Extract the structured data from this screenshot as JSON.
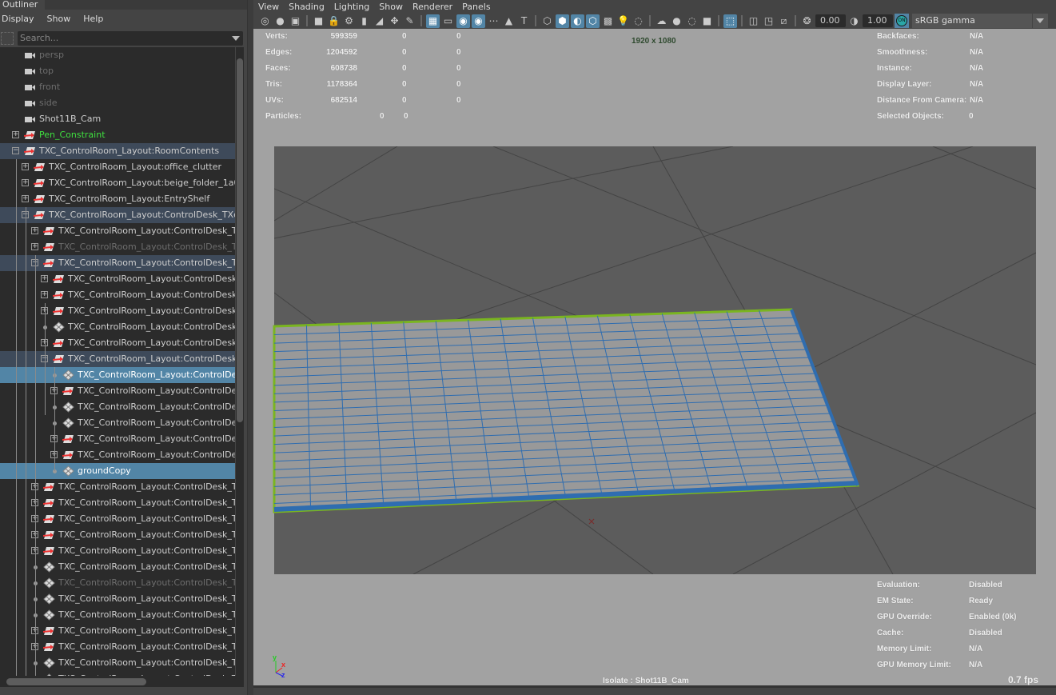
{
  "outliner": {
    "tab": "Outliner",
    "menu": [
      "Display",
      "Show",
      "Help"
    ],
    "search_placeholder": "Search...",
    "rows": [
      {
        "name": "persp",
        "level": 0,
        "exp": "none",
        "icon": "camera",
        "state": "dim"
      },
      {
        "name": "top",
        "level": 0,
        "exp": "none",
        "icon": "camera",
        "state": "dim"
      },
      {
        "name": "front",
        "level": 0,
        "exp": "none",
        "icon": "camera",
        "state": "dim"
      },
      {
        "name": "side",
        "level": 0,
        "exp": "none",
        "icon": "camera",
        "state": "dim"
      },
      {
        "name": "Shot11B_Cam",
        "level": 0,
        "exp": "none",
        "icon": "camera",
        "state": ""
      },
      {
        "name": "Pen_Constraint",
        "level": 0,
        "exp": "plus",
        "icon": "transform",
        "state": "green"
      },
      {
        "name": "TXC_ControlRoom_Layout:RoomContents",
        "level": 0,
        "exp": "minus",
        "icon": "transform",
        "state": "hl"
      },
      {
        "name": "TXC_ControlRoom_Layout:office_clutter",
        "level": 1,
        "exp": "plus",
        "icon": "transform",
        "state": ""
      },
      {
        "name": "TXC_ControlRoom_Layout:beige_folder_1a04",
        "level": 1,
        "exp": "plus",
        "icon": "transform",
        "state": ""
      },
      {
        "name": "TXC_ControlRoom_Layout:EntryShelf",
        "level": 1,
        "exp": "plus",
        "icon": "transform",
        "state": ""
      },
      {
        "name": "TXC_ControlRoom_Layout:ControlDesk_TXc:C",
        "level": 1,
        "exp": "minus",
        "icon": "transform",
        "state": "hl"
      },
      {
        "name": "TXC_ControlRoom_Layout:ControlDesk_TXc",
        "level": 2,
        "exp": "plus",
        "icon": "transform",
        "state": ""
      },
      {
        "name": "TXC_ControlRoom_Layout:ControlDesk_TXc",
        "level": 2,
        "exp": "plus",
        "icon": "transform",
        "state": "dim"
      },
      {
        "name": "TXC_ControlRoom_Layout:ControlDesk_TXc",
        "level": 2,
        "exp": "minus",
        "icon": "transform",
        "state": "hl"
      },
      {
        "name": "TXC_ControlRoom_Layout:ControlDesk_T",
        "level": 3,
        "exp": "plus",
        "icon": "transform",
        "state": ""
      },
      {
        "name": "TXC_ControlRoom_Layout:ControlDesk_T",
        "level": 3,
        "exp": "plus",
        "icon": "transform",
        "state": ""
      },
      {
        "name": "TXC_ControlRoom_Layout:ControlDesk_T",
        "level": 3,
        "exp": "plus",
        "icon": "transform",
        "state": ""
      },
      {
        "name": "TXC_ControlRoom_Layout:ControlDesk_T",
        "level": 3,
        "exp": "dot",
        "icon": "mesh",
        "state": ""
      },
      {
        "name": "TXC_ControlRoom_Layout:ControlDesk_T",
        "level": 3,
        "exp": "plus",
        "icon": "transform",
        "state": ""
      },
      {
        "name": "TXC_ControlRoom_Layout:ControlDesk_T",
        "level": 3,
        "exp": "minus",
        "icon": "transform",
        "state": "hl"
      },
      {
        "name": "TXC_ControlRoom_Layout:ControlDesk",
        "level": 4,
        "exp": "dot",
        "icon": "mesh",
        "state": "sel"
      },
      {
        "name": "TXC_ControlRoom_Layout:ControlDesk",
        "level": 4,
        "exp": "plus",
        "icon": "transform",
        "state": ""
      },
      {
        "name": "TXC_ControlRoom_Layout:ControlDesk",
        "level": 4,
        "exp": "dot",
        "icon": "mesh",
        "state": ""
      },
      {
        "name": "TXC_ControlRoom_Layout:ControlDesk",
        "level": 4,
        "exp": "dot",
        "icon": "mesh",
        "state": ""
      },
      {
        "name": "TXC_ControlRoom_Layout:ControlDesk",
        "level": 4,
        "exp": "plus",
        "icon": "transform",
        "state": ""
      },
      {
        "name": "TXC_ControlRoom_Layout:ControlDesk",
        "level": 4,
        "exp": "plus",
        "icon": "transform",
        "state": ""
      },
      {
        "name": "groundCopy",
        "level": 4,
        "exp": "dot",
        "icon": "mesh",
        "state": "sel"
      },
      {
        "name": "TXC_ControlRoom_Layout:ControlDesk_TXc",
        "level": 2,
        "exp": "plus",
        "icon": "transform",
        "state": ""
      },
      {
        "name": "TXC_ControlRoom_Layout:ControlDesk_TXc",
        "level": 2,
        "exp": "plus",
        "icon": "transform",
        "state": ""
      },
      {
        "name": "TXC_ControlRoom_Layout:ControlDesk_TXc",
        "level": 2,
        "exp": "plus",
        "icon": "transform",
        "state": ""
      },
      {
        "name": "TXC_ControlRoom_Layout:ControlDesk_TXc",
        "level": 2,
        "exp": "plus",
        "icon": "transform",
        "state": ""
      },
      {
        "name": "TXC_ControlRoom_Layout:ControlDesk_TXc",
        "level": 2,
        "exp": "plus",
        "icon": "transform",
        "state": ""
      },
      {
        "name": "TXC_ControlRoom_Layout:ControlDesk_TXc",
        "level": 2,
        "exp": "dot",
        "icon": "mesh",
        "state": ""
      },
      {
        "name": "TXC_ControlRoom_Layout:ControlDesk_TXc",
        "level": 2,
        "exp": "dot",
        "icon": "mesh",
        "state": "dim"
      },
      {
        "name": "TXC_ControlRoom_Layout:ControlDesk_TXc",
        "level": 2,
        "exp": "dot",
        "icon": "mesh",
        "state": ""
      },
      {
        "name": "TXC_ControlRoom_Layout:ControlDesk_TXc",
        "level": 2,
        "exp": "dot",
        "icon": "mesh",
        "state": ""
      },
      {
        "name": "TXC_ControlRoom_Layout:ControlDesk_TXc",
        "level": 2,
        "exp": "plus",
        "icon": "transform",
        "state": ""
      },
      {
        "name": "TXC_ControlRoom_Layout:ControlDesk_TXc",
        "level": 2,
        "exp": "plus",
        "icon": "transform",
        "state": ""
      },
      {
        "name": "TXC_ControlRoom_Layout:ControlDesk_TXc",
        "level": 2,
        "exp": "dot",
        "icon": "mesh",
        "state": ""
      },
      {
        "name": "TXC_ControlRoom_Layout:ControlDesk_TXc",
        "level": 2,
        "exp": "dot",
        "icon": "mesh",
        "state": ""
      }
    ]
  },
  "viewport": {
    "menu": [
      "View",
      "Shading",
      "Lighting",
      "Show",
      "Renderer",
      "Panels"
    ],
    "toolbar": [
      {
        "icon": "select-camera-icon",
        "glyph": "◎"
      },
      {
        "icon": "camera-attributes-icon",
        "glyph": "●"
      },
      {
        "icon": "bookmark-icon",
        "glyph": "▣"
      },
      {
        "sep": true
      },
      {
        "icon": "camera-icon",
        "glyph": "■"
      },
      {
        "icon": "lock-camera-icon",
        "glyph": "🔒"
      },
      {
        "icon": "camera-attr-icon",
        "glyph": "⚙"
      },
      {
        "icon": "bookmark2-icon",
        "glyph": "▮"
      },
      {
        "icon": "image-plane-icon",
        "glyph": "◢"
      },
      {
        "icon": "2d-pan-zoom-icon",
        "glyph": "✥"
      },
      {
        "icon": "grease-pencil-icon",
        "glyph": "✎"
      },
      {
        "sep": true
      },
      {
        "icon": "grid-icon",
        "glyph": "▦",
        "on": true
      },
      {
        "icon": "film-gate-icon",
        "glyph": "▭"
      },
      {
        "icon": "resolution-gate-icon",
        "glyph": "◉",
        "on": true
      },
      {
        "icon": "gate-mask-icon",
        "glyph": "◉",
        "on": true
      },
      {
        "icon": "field-chart-icon",
        "glyph": "⋯"
      },
      {
        "icon": "safe-action-icon",
        "glyph": "▲"
      },
      {
        "icon": "safe-title-icon",
        "glyph": "T"
      },
      {
        "sep": true
      },
      {
        "icon": "wireframe-icon",
        "glyph": "⬡"
      },
      {
        "icon": "smooth-shade-icon",
        "glyph": "⬢",
        "on": true
      },
      {
        "icon": "default-material-icon",
        "glyph": "◐",
        "on": true
      },
      {
        "icon": "wireframe-on-shaded-icon",
        "glyph": "⬡",
        "on": true
      },
      {
        "icon": "xray-icon",
        "glyph": "▩"
      },
      {
        "icon": "lights-icon",
        "glyph": "💡"
      },
      {
        "icon": "shadows-icon",
        "glyph": "◌"
      },
      {
        "sep": true
      },
      {
        "icon": "ambient-occlusion-icon",
        "glyph": "☁"
      },
      {
        "icon": "motion-blur-icon",
        "glyph": "●"
      },
      {
        "icon": "anti-alias-icon",
        "glyph": "◌"
      },
      {
        "icon": "depth-of-field-icon",
        "glyph": "■"
      },
      {
        "sep": true
      },
      {
        "icon": "isolate-select-icon",
        "glyph": "⬚",
        "on": true
      },
      {
        "sep": true
      },
      {
        "icon": "xray-joints-icon",
        "glyph": "◫"
      },
      {
        "icon": "xray-active-icon",
        "glyph": "◳"
      },
      {
        "icon": "backface-icon",
        "glyph": "⧄"
      },
      {
        "sep": true
      },
      {
        "icon": "exposure-icon",
        "glyph": "❂",
        "value": "0.00"
      },
      {
        "icon": "gamma-icon",
        "glyph": "◑",
        "value": "1.00"
      }
    ],
    "color_management": "ON",
    "color_space": "sRGB gamma",
    "resolution": "1920 x 1080",
    "stats": [
      {
        "label": "Verts:",
        "v": [
          "599359",
          "0",
          "0"
        ]
      },
      {
        "label": "Edges:",
        "v": [
          "1204592",
          "0",
          "0"
        ]
      },
      {
        "label": "Faces:",
        "v": [
          "608738",
          "0",
          "0"
        ]
      },
      {
        "label": "Tris:",
        "v": [
          "1178364",
          "0",
          "0"
        ]
      },
      {
        "label": "UVs:",
        "v": [
          "682514",
          "0",
          "0"
        ]
      }
    ],
    "particles": {
      "label": "Particles:",
      "v": [
        "0",
        "0"
      ]
    },
    "info": [
      {
        "label": "Backfaces:",
        "v": "N/A"
      },
      {
        "label": "Smoothness:",
        "v": "N/A"
      },
      {
        "label": "Instance:",
        "v": "N/A"
      },
      {
        "label": "Display Layer:",
        "v": "N/A"
      },
      {
        "label": "Distance From Camera:",
        "v": "N/A"
      },
      {
        "label": "Selected Objects:",
        "v": "0"
      }
    ],
    "eval": [
      {
        "label": "Evaluation:",
        "v": "Disabled"
      },
      {
        "label": "EM State:",
        "v": "Ready"
      },
      {
        "label": "GPU Override:",
        "v": "Enabled (0k)"
      },
      {
        "label": "Cache:",
        "v": "Disabled"
      },
      {
        "label": "Memory Limit:",
        "v": "N/A"
      },
      {
        "label": "GPU Memory Limit:",
        "v": "N/A"
      }
    ],
    "isolate": "Isolate : Shot11B_Cam",
    "fps": "0.7 fps",
    "axis": {
      "x": "x",
      "y": "y",
      "z": "z"
    },
    "colors": {
      "selection": "#5285a6",
      "wire": "#2f6db0",
      "highlight": "#7ab520",
      "viewport_bg": "#a2a2a2",
      "gate": "#5c5c5c"
    }
  }
}
